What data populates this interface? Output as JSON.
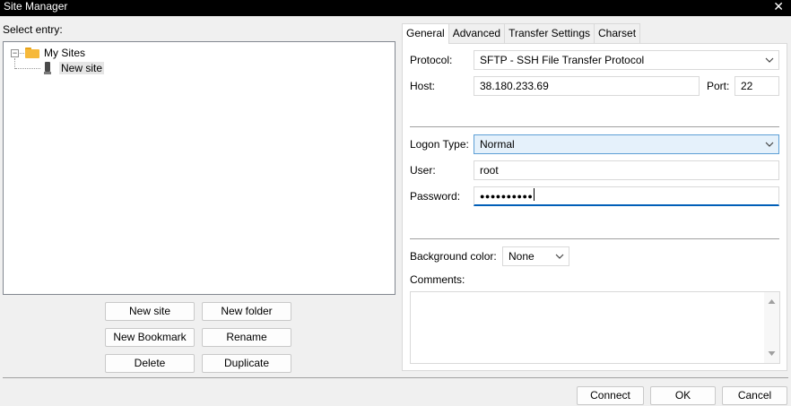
{
  "window": {
    "title": "Site Manager",
    "close_glyph": "✕"
  },
  "left": {
    "select_entry_label": "Select entry:",
    "tree": {
      "root": {
        "label": "My Sites",
        "icon": "folder-icon",
        "expander": "−"
      },
      "child": {
        "label": "New site",
        "icon": "server-icon",
        "selected": true
      }
    },
    "buttons": {
      "new_site": "New site",
      "new_folder": "New folder",
      "new_bookmark": "New Bookmark",
      "rename": "Rename",
      "delete": "Delete",
      "duplicate": "Duplicate"
    }
  },
  "tabs": [
    {
      "label": "General",
      "active": true
    },
    {
      "label": "Advanced",
      "active": false
    },
    {
      "label": "Transfer Settings",
      "active": false
    },
    {
      "label": "Charset",
      "active": false
    }
  ],
  "general": {
    "protocol_label": "Protocol:",
    "protocol_value": "SFTP - SSH File Transfer Protocol",
    "host_label": "Host:",
    "host_value": "38.180.233.69",
    "port_label": "Port:",
    "port_value": "22",
    "logon_type_label": "Logon Type:",
    "logon_type_value": "Normal",
    "user_label": "User:",
    "user_value": "root",
    "password_label": "Password:",
    "password_value": "●●●●●●●●●●",
    "background_color_label": "Background color:",
    "background_color_value": "None",
    "comments_label": "Comments:",
    "comments_value": ""
  },
  "footer": {
    "connect": "Connect",
    "ok": "OK",
    "cancel": "Cancel"
  },
  "colors": {
    "titlebar": "#000000",
    "focus_accent": "#005fb8",
    "dropdown_highlight": "#e5f1fb",
    "folder": "#f6b93b"
  }
}
